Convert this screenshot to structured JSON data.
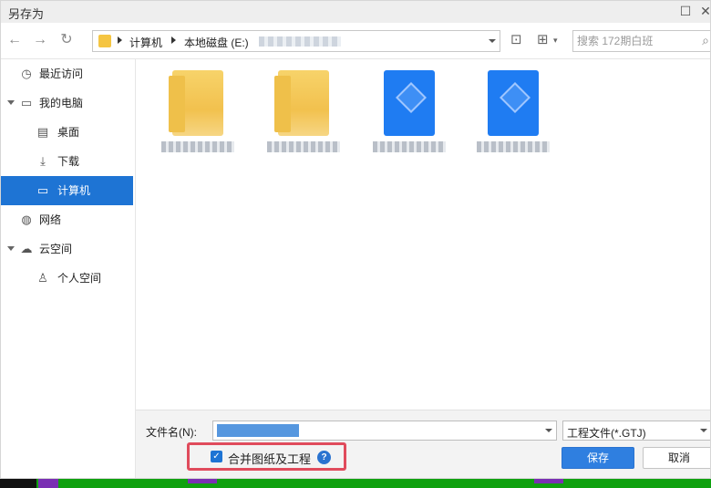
{
  "window": {
    "title": "另存为"
  },
  "toolbar": {
    "path": [
      "计算机",
      "本地磁盘 (E:)"
    ],
    "search_placeholder": "搜索 172期白班"
  },
  "sidebar": {
    "items": [
      {
        "label": "最近访问",
        "icon": "clock-icon"
      },
      {
        "label": "我的电脑",
        "icon": "monitor-icon"
      },
      {
        "label": "桌面",
        "icon": "desktop-icon"
      },
      {
        "label": "下载",
        "icon": "download-icon"
      },
      {
        "label": "计算机",
        "icon": "computer-icon",
        "active": true
      },
      {
        "label": "网络",
        "icon": "globe-icon"
      },
      {
        "label": "云空间",
        "icon": "cloud-icon"
      },
      {
        "label": "个人空间",
        "icon": "person-icon"
      }
    ]
  },
  "files": [
    {
      "type": "folder"
    },
    {
      "type": "folder"
    },
    {
      "type": "gtj"
    },
    {
      "type": "gtj"
    }
  ],
  "bottom": {
    "filename_label": "文件名(N):",
    "filetype": "工程文件(*.GTJ)",
    "merge_label": "合并图纸及工程",
    "merge_checked": true,
    "save_label": "保存",
    "cancel_label": "取消"
  },
  "colors": {
    "accent": "#1e74d4",
    "highlight_border": "#e04b5c"
  }
}
